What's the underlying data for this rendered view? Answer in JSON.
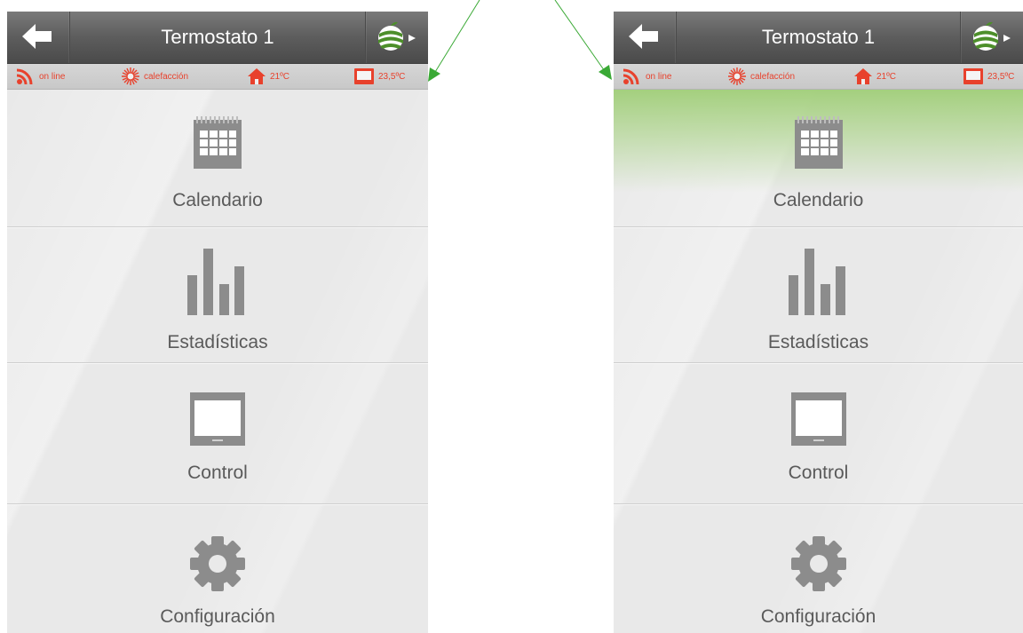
{
  "header": {
    "title": "Termostato 1"
  },
  "status": {
    "connection": "on line",
    "mode": "calefacción",
    "home_temp": "21ºC",
    "device_temp": "23,5ºC"
  },
  "menu": {
    "calendar": "Calendario",
    "statistics": "Estadísticas",
    "control": "Control",
    "config": "Configuración"
  },
  "device_brand": "momit",
  "colors": {
    "accent_red": "#e8412c",
    "header_gray": "#5d5d5d",
    "highlight_green": "#a0ce78",
    "arrow_green": "#3aa935",
    "icon_gray": "#8c8c8c"
  },
  "icons": [
    "back-arrow-icon",
    "momit-logo-icon",
    "wifi-signal-icon",
    "heating-sun-icon",
    "home-icon",
    "thermostat-device-icon",
    "calendar-icon",
    "bar-chart-icon",
    "control-device-icon",
    "gear-icon"
  ]
}
